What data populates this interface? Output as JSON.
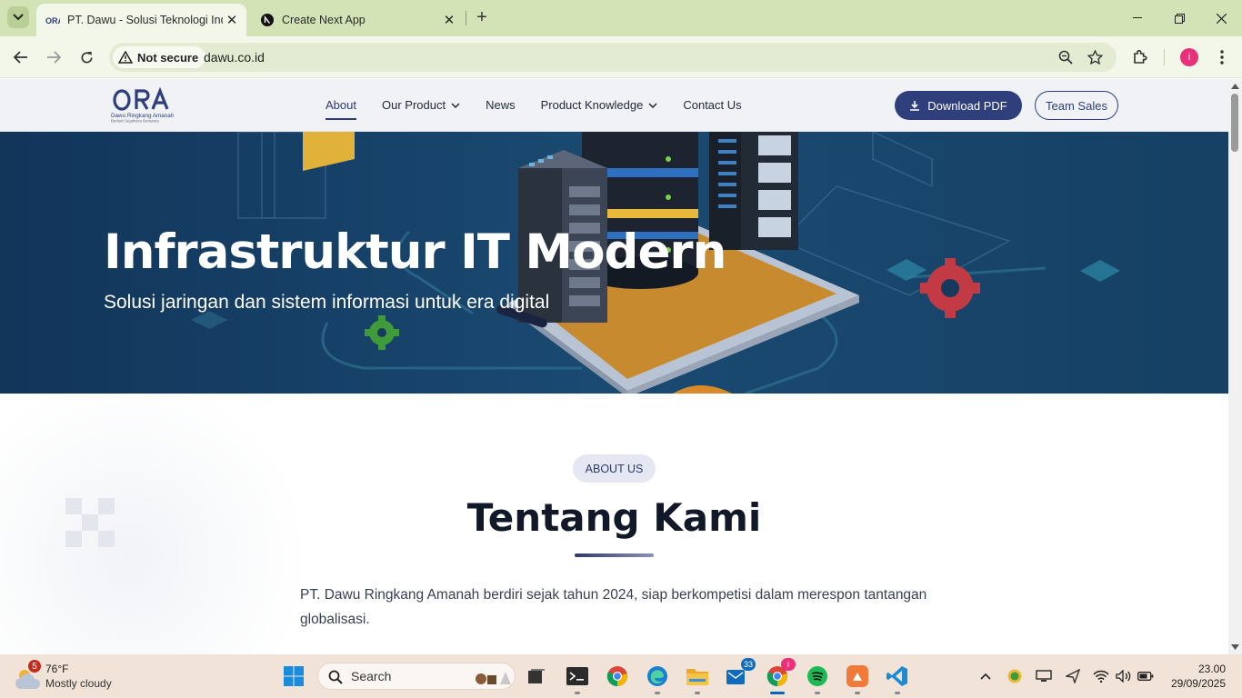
{
  "browser": {
    "tabs": [
      {
        "title": "PT. Dawu - Solusi Teknologi Indonesia",
        "active": true,
        "favicon": "dawu-logo-icon"
      },
      {
        "title": "Create Next App",
        "active": false,
        "favicon": "nextjs-icon"
      }
    ],
    "address": {
      "security_label": "Not secure",
      "url": "dawu.co.id"
    },
    "profile_initial": "i"
  },
  "site": {
    "logo": {
      "name": "ORA",
      "tagline_1": "Dawu Ringkang Amanah",
      "tagline_2": "Berkah Sejahtera Bersama"
    },
    "nav": [
      {
        "label": "About",
        "active": true,
        "dropdown": false
      },
      {
        "label": "Our Product",
        "active": false,
        "dropdown": true
      },
      {
        "label": "News",
        "active": false,
        "dropdown": false
      },
      {
        "label": "Product Knowledge",
        "active": false,
        "dropdown": true
      },
      {
        "label": "Contact Us",
        "active": false,
        "dropdown": false
      }
    ],
    "download_label": "Download PDF",
    "team_sales_label": "Team Sales",
    "hero": {
      "title": "Infrastruktur IT Modern",
      "subtitle": "Solusi jaringan dan sistem informasi untuk era digital"
    },
    "about": {
      "badge": "ABOUT US",
      "title": "Tentang Kami",
      "text": "PT. Dawu Ringkang Amanah berdiri sejak tahun 2024, siap berkompetisi dalam merespon tantangan globalisasi."
    }
  },
  "taskbar": {
    "weather": {
      "temp": "76°F",
      "condition": "Mostly cloudy",
      "badge": "5"
    },
    "search_label": "Search",
    "badges": {
      "mail": "33",
      "chrome": "i"
    },
    "clock": {
      "time": "23.00",
      "date": "29/09/2025"
    }
  },
  "colors": {
    "brand": "#2e3f7c",
    "hero_bg": "#153a5e",
    "tab_strip": "#d3e3b5",
    "taskbar": "#f1e3d8"
  }
}
